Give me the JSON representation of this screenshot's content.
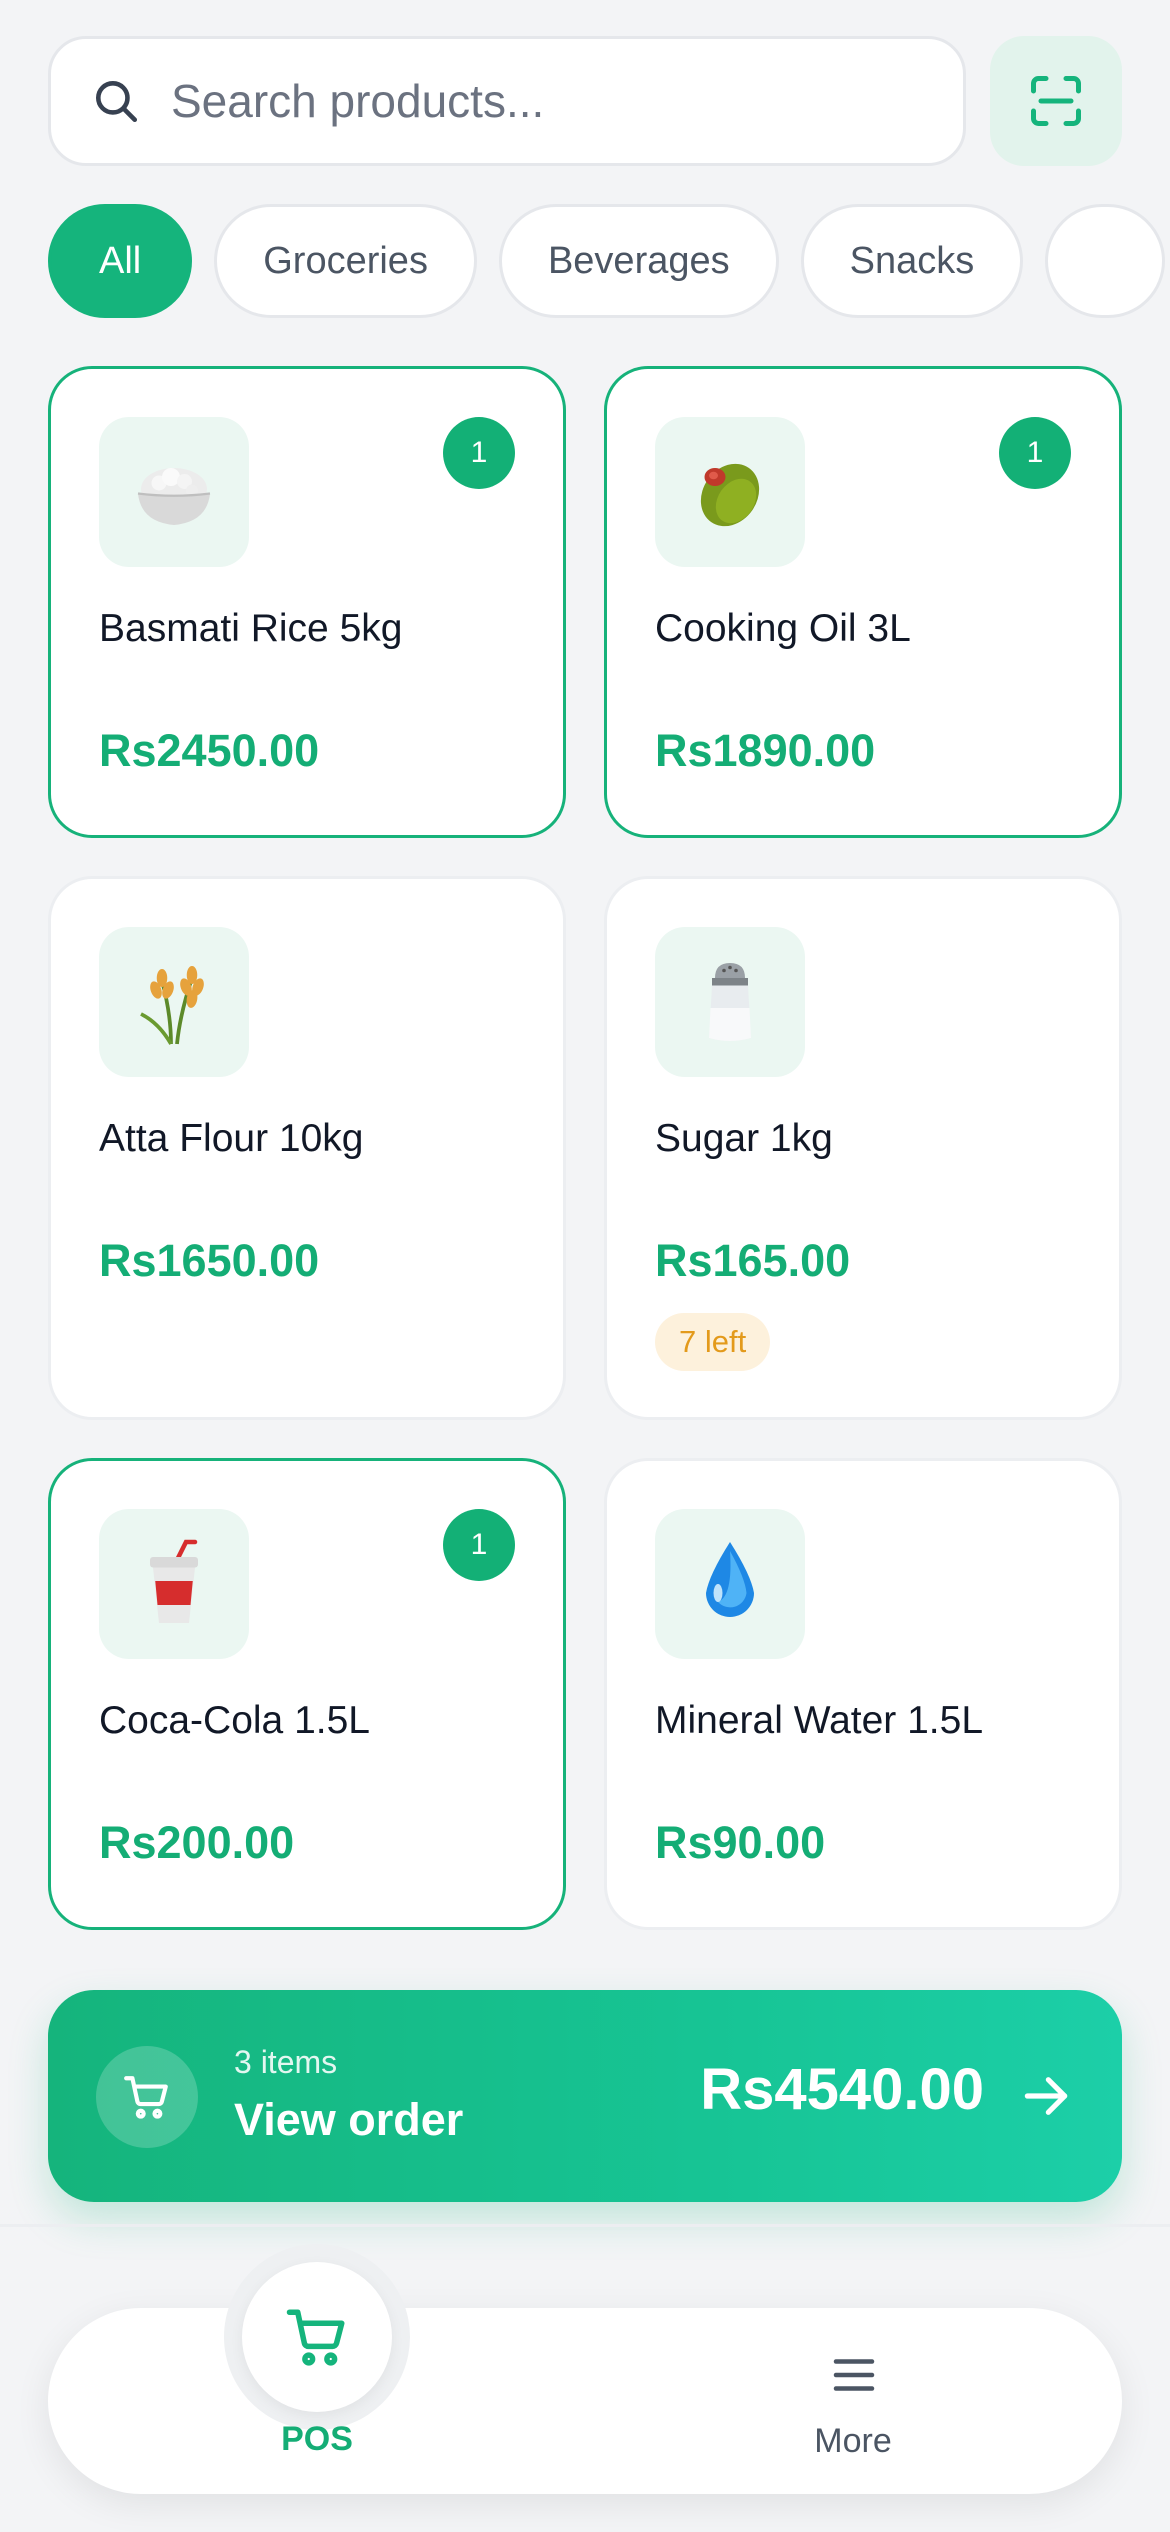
{
  "search": {
    "placeholder": "Search products..."
  },
  "categories": [
    {
      "label": "All",
      "active": true
    },
    {
      "label": "Groceries",
      "active": false
    },
    {
      "label": "Beverages",
      "active": false
    },
    {
      "label": "Snacks",
      "active": false
    }
  ],
  "products": [
    {
      "name": "Basmati Rice 5kg",
      "price": "Rs2450.00",
      "qty": "1",
      "icon": "rice-bowl-icon",
      "selected": true
    },
    {
      "name": "Cooking Oil 3L",
      "price": "Rs1890.00",
      "qty": "1",
      "icon": "olive-icon",
      "selected": true
    },
    {
      "name": "Atta Flour 10kg",
      "price": "Rs1650.00",
      "icon": "wheat-icon",
      "selected": false
    },
    {
      "name": "Sugar 1kg",
      "price": "Rs165.00",
      "stock": "7 left",
      "icon": "salt-shaker-icon",
      "selected": false
    },
    {
      "name": "Coca-Cola 1.5L",
      "price": "Rs200.00",
      "qty": "1",
      "icon": "cup-straw-icon",
      "selected": true
    },
    {
      "name": "Mineral Water 1.5L",
      "price": "Rs90.00",
      "icon": "water-drop-icon",
      "selected": false
    }
  ],
  "order": {
    "count_text": "3 items",
    "label": "View order",
    "total": "Rs4540.00"
  },
  "nav": {
    "pos_label": "POS",
    "more_label": "More"
  },
  "colors": {
    "accent": "#15b47c",
    "accent_light": "#ebf7f2",
    "warning_bg": "#fdf1dc",
    "warning_text": "#e39a1b",
    "background": "#f3f4f6"
  }
}
